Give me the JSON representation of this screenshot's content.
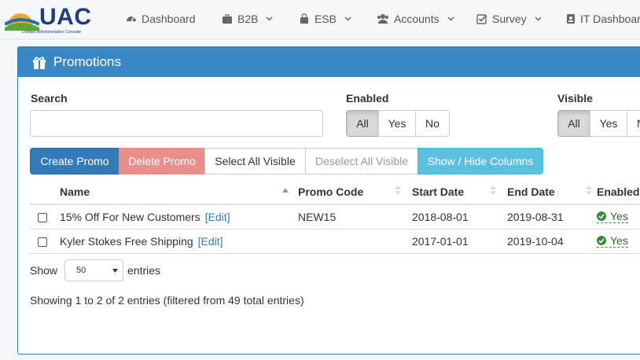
{
  "brand": {
    "name": "UAC",
    "subtitle": "Unified Administration Console",
    "colors": {
      "blue": "#1f3e7a",
      "sun": "#f39c12",
      "green": "#5aa832",
      "sky": "#3a87c6"
    }
  },
  "nav": {
    "items": [
      {
        "label": "Dashboard",
        "icon": "dashboard-icon",
        "dropdown": false
      },
      {
        "label": "B2B",
        "icon": "briefcase-icon",
        "dropdown": true
      },
      {
        "label": "ESB",
        "icon": "shopping-bag-icon",
        "dropdown": true
      },
      {
        "label": "Accounts",
        "icon": "users-icon",
        "dropdown": true
      },
      {
        "label": "Survey",
        "icon": "checkbox-icon",
        "dropdown": true
      },
      {
        "label": "IT Dashboard",
        "icon": "id-badge-icon",
        "dropdown": false
      }
    ]
  },
  "panel": {
    "title": "Promotions",
    "icon": "gift-icon",
    "accent": "#3a87c6"
  },
  "filters": {
    "search_label": "Search",
    "search_value": "",
    "enabled_label": "Enabled",
    "enabled_options": [
      "All",
      "Yes",
      "No"
    ],
    "enabled_selected": "All",
    "visible_label": "Visible",
    "visible_options": [
      "All",
      "Yes",
      "No"
    ],
    "visible_selected": "All"
  },
  "actions": {
    "create": "Create Promo",
    "delete": "Delete Promo",
    "select_all": "Select All Visible",
    "deselect_all": "Deselect All Visible",
    "show_hide": "Show / Hide Columns"
  },
  "table": {
    "columns": [
      "Name",
      "Promo Code",
      "Start Date",
      "End Date",
      "Enabled"
    ],
    "edit_label": "[Edit]",
    "rows": [
      {
        "name": "15% Off For New Customers",
        "code": "NEW15",
        "start": "2018-08-01",
        "end": "2019-08-31",
        "enabled": "Yes"
      },
      {
        "name": "Kyler Stokes Free Shipping",
        "code": "",
        "start": "2017-01-01",
        "end": "2019-10-04",
        "enabled": "Yes"
      }
    ]
  },
  "paging": {
    "show_label": "Show",
    "page_size": "50",
    "entries_label": "entries",
    "info": "Showing 1 to 2 of 2 entries (filtered from 49 total entries)"
  }
}
